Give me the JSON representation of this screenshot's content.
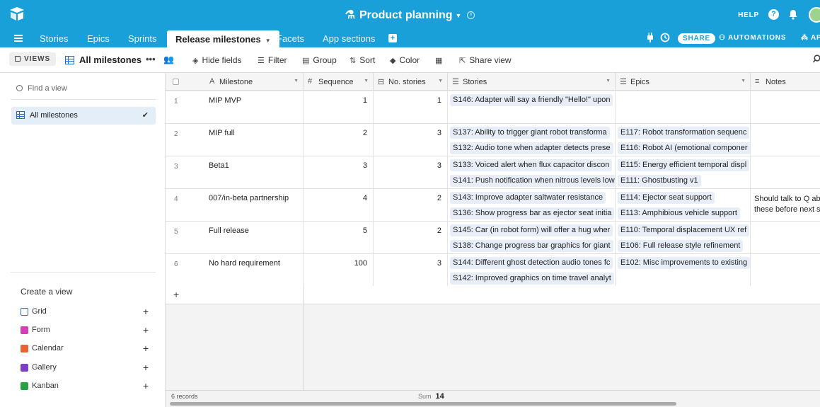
{
  "app": {
    "base_name": "Product planning",
    "help_label": "HELP"
  },
  "tabs": {
    "items": [
      {
        "label": "Stories"
      },
      {
        "label": "Epics"
      },
      {
        "label": "Sprints"
      },
      {
        "label": "Release milestones",
        "active": true
      },
      {
        "label": "Facets"
      },
      {
        "label": "App sections"
      }
    ],
    "share_label": "SHARE",
    "automations_label": "AUTOMATIONS",
    "apps_label": "APPS"
  },
  "toolbar": {
    "views_label": "VIEWS",
    "view_name": "All milestones",
    "more_label": "•••",
    "hide_fields": "Hide fields",
    "filter": "Filter",
    "group": "Group",
    "sort": "Sort",
    "color": "Color",
    "share_view": "Share view"
  },
  "sidebar": {
    "find_placeholder": "Find a view",
    "views": [
      {
        "label": "All milestones",
        "selected": true
      }
    ],
    "create_title": "Create a view",
    "view_types": [
      {
        "label": "Grid",
        "color": "#1c6fd1"
      },
      {
        "label": "Form",
        "color": "#d43fb9"
      },
      {
        "label": "Calendar",
        "color": "#e8632f"
      },
      {
        "label": "Gallery",
        "color": "#7b3fc4"
      },
      {
        "label": "Kanban",
        "color": "#27a243"
      }
    ]
  },
  "grid": {
    "columns": [
      {
        "label": "Milestone",
        "icon": "text-icon"
      },
      {
        "label": "Sequence",
        "icon": "hash-icon"
      },
      {
        "label": "No. stories",
        "icon": "rollup-icon"
      },
      {
        "label": "Stories",
        "icon": "link-icon"
      },
      {
        "label": "Epics",
        "icon": "link-icon"
      },
      {
        "label": "Notes",
        "icon": "long-text-icon"
      }
    ],
    "rows": [
      {
        "n": "1",
        "milestone": "MIP MVP",
        "sequence": "1",
        "stories_count": "1",
        "stories": [
          "S146: Adapter will say a friendly \"Hello!\" upon"
        ],
        "epics": [],
        "notes": []
      },
      {
        "n": "2",
        "milestone": "MIP full",
        "sequence": "2",
        "stories_count": "3",
        "stories": [
          "S137: Ability to trigger giant robot transforma",
          "S132: Audio tone when adapter detects prese"
        ],
        "epics": [
          "E117: Robot transformation sequenc",
          "E116: Robot AI (emotional componer"
        ],
        "notes": []
      },
      {
        "n": "3",
        "milestone": "Beta1",
        "sequence": "3",
        "stories_count": "3",
        "stories": [
          "S133: Voiced alert when flux capacitor discon",
          "S141: Push notification when nitrous levels low"
        ],
        "epics": [
          "E115: Energy efficient temporal displ",
          "E111: Ghostbusting v1"
        ],
        "notes": []
      },
      {
        "n": "4",
        "milestone": "007/in-beta partnership",
        "sequence": "4",
        "stories_count": "2",
        "stories": [
          "S143: Improve adapter saltwater resistance",
          "S136: Show progress bar as ejector seat initia"
        ],
        "epics": [
          "E114: Ejector seat support",
          "E113: Amphibious vehicle support"
        ],
        "notes": [
          "Should talk to Q ab",
          "these before next s"
        ]
      },
      {
        "n": "5",
        "milestone": "Full release",
        "sequence": "5",
        "stories_count": "2",
        "stories": [
          "S145: Car (in robot form) will offer a hug wher",
          "S138: Change progress bar graphics for giant"
        ],
        "epics": [
          "E110: Temporal displacement UX ref",
          "E106: Full release style refinement"
        ],
        "notes": []
      },
      {
        "n": "6",
        "milestone": "No hard requirement",
        "sequence": "100",
        "stories_count": "3",
        "stories": [
          "S144: Different ghost detection audio tones fc",
          "S142: Improved graphics on time travel analyt"
        ],
        "epics": [
          "E102: Misc improvements to existing"
        ],
        "notes": []
      }
    ],
    "add_row_label": "+",
    "records_label": "6 records",
    "sum_label": "Sum",
    "sum_value": "14"
  }
}
